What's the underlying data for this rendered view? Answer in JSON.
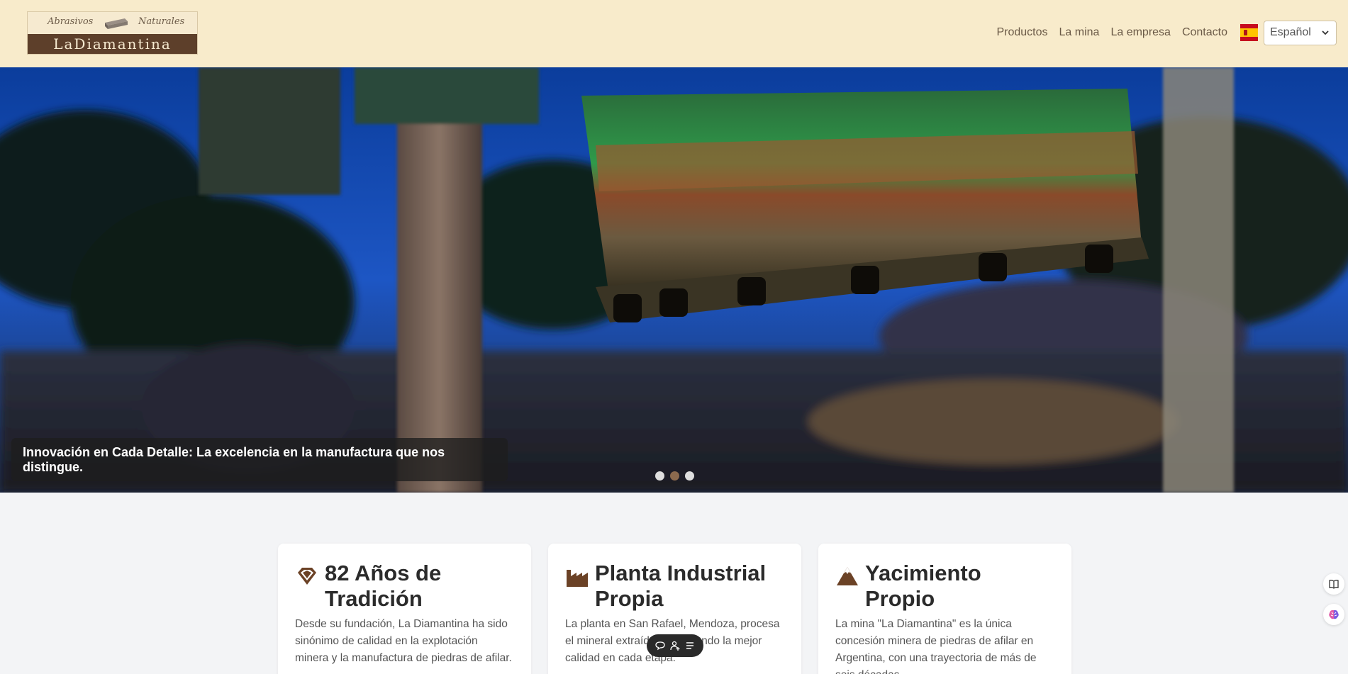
{
  "header": {
    "logo": {
      "script_left": "Abrasivos",
      "script_right": "Naturales",
      "wordmark": "LaDiamantina"
    },
    "nav": [
      {
        "label": "Productos"
      },
      {
        "label": "La mina"
      },
      {
        "label": "La empresa"
      },
      {
        "label": "Contacto"
      }
    ],
    "language": {
      "flag_icon": "spain-flag-icon",
      "selected": "Español"
    }
  },
  "hero": {
    "caption": "Innovación en Cada Detalle: La excelencia en la manufactura que nos distingue.",
    "slide_count": 3,
    "active_slide": 2
  },
  "cards": [
    {
      "icon": "diamond-icon",
      "title": "82 Años de Tradición",
      "body": "Desde su fundación, La Diamantina ha sido sinónimo de calidad en la explotación minera y la manufactura de piedras de afilar."
    },
    {
      "icon": "factory-icon",
      "title": "Planta Industrial Propia",
      "body": "La planta en San Rafael, Mendoza, procesa el mineral extraído, asegurando la mejor calidad en cada etapa."
    },
    {
      "icon": "mountain-icon",
      "title": "Yacimiento Propio",
      "body": "La mina \"La Diamantina\" es la única concesión minera de piedras de afilar en Argentina, con una trayectoria de más de seis décadas."
    }
  ],
  "floating_toolbar": {
    "icons": [
      "chat-icon",
      "user-add-icon",
      "list-icon"
    ]
  },
  "side_buttons": [
    "book-icon",
    "brain-icon"
  ],
  "colors": {
    "header_bg": "#f8ebcb",
    "brand_brown": "#5d3f2a",
    "nav_text": "#6b5a47",
    "page_bg": "#f3f4f6"
  }
}
